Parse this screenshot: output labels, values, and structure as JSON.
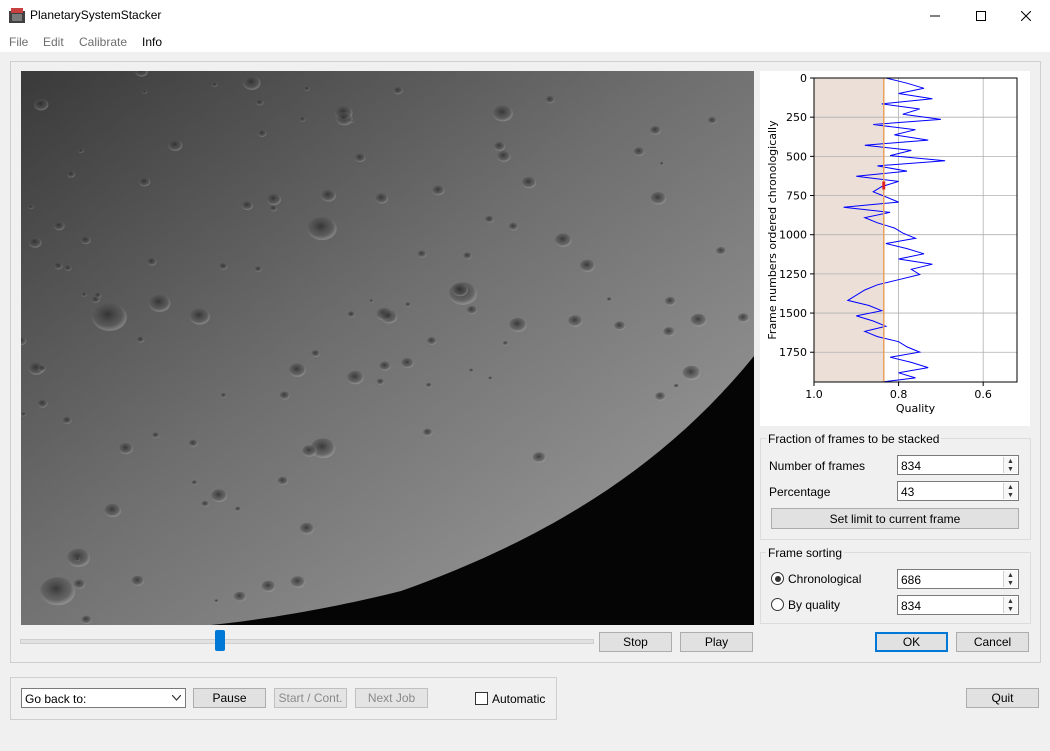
{
  "window": {
    "title": "PlanetarySystemStacker",
    "minimize_icon": "minimize-icon",
    "maximize_icon": "maximize-icon",
    "close_icon": "close-icon"
  },
  "menu": [
    "File",
    "Edit",
    "Calibrate",
    "Info"
  ],
  "frame_viewer": {
    "slider_fraction": 0.35,
    "stop_label": "Stop",
    "play_label": "Play"
  },
  "chart_data": {
    "type": "line",
    "ylabel": "Frame numbers ordered chronologically",
    "xlabel": "Quality",
    "xlim": [
      1.0,
      0.52
    ],
    "ylim": [
      0,
      1940
    ],
    "x_ticks": [
      "1.0",
      "0.8",
      "0.6"
    ],
    "y_ticks": [
      "0",
      "250",
      "500",
      "750",
      "1000",
      "1250",
      "1500",
      "1750"
    ],
    "grid": true,
    "y_inverted": true,
    "x_inverted": true,
    "series": [
      {
        "color": "#0000ff",
        "note_points": "quality per frame, sampled",
        "x": [
          0.83,
          0.78,
          0.74,
          0.8,
          0.72,
          0.84,
          0.75,
          0.79,
          0.7,
          0.86,
          0.76,
          0.81,
          0.73,
          0.88,
          0.77,
          0.82,
          0.69,
          0.85,
          0.78,
          0.9,
          0.8,
          0.84,
          0.86,
          0.83,
          0.8,
          0.93,
          0.82,
          0.88,
          0.85,
          0.81,
          0.79,
          0.76,
          0.83,
          0.78,
          0.74,
          0.8,
          0.72,
          0.77,
          0.75,
          0.8,
          0.85,
          0.88,
          0.9,
          0.92,
          0.87,
          0.84,
          0.9,
          0.86,
          0.83,
          0.88,
          0.85,
          0.8,
          0.78,
          0.75,
          0.82,
          0.77,
          0.73,
          0.8,
          0.76,
          0.84
        ],
        "y": [
          0,
          33,
          66,
          99,
          132,
          165,
          198,
          231,
          264,
          297,
          330,
          363,
          396,
          429,
          462,
          495,
          528,
          561,
          594,
          627,
          660,
          693,
          726,
          759,
          792,
          825,
          858,
          891,
          924,
          957,
          990,
          1023,
          1056,
          1089,
          1122,
          1155,
          1188,
          1221,
          1254,
          1287,
          1320,
          1353,
          1386,
          1419,
          1452,
          1485,
          1518,
          1551,
          1584,
          1617,
          1650,
          1683,
          1716,
          1749,
          1782,
          1815,
          1848,
          1881,
          1914,
          1940
        ]
      }
    ],
    "threshold_quality": 0.835,
    "current_frame": 686,
    "shaded_span_quality": [
      1.0,
      0.835
    ]
  },
  "stack_fraction": {
    "group_title": "Fraction of frames to be stacked",
    "frames_label": "Number of frames",
    "frames_value": "834",
    "percent_label": "Percentage",
    "percent_value": "43",
    "set_limit_label": "Set limit to current frame"
  },
  "frame_sorting": {
    "group_title": "Frame sorting",
    "chrono_label": "Chronological",
    "chrono_value": "686",
    "quality_label": "By quality",
    "quality_value": "834",
    "selected": "Chronological"
  },
  "dialog_buttons": {
    "ok": "OK",
    "cancel": "Cancel"
  },
  "workflow": {
    "go_back_label": "Go back to:",
    "chevron_icon": "chevron-down-icon",
    "pause": "Pause",
    "start_cont": "Start / Cont.",
    "next_job": "Next Job",
    "automatic": "Automatic",
    "automatic_checked": false
  },
  "quit_label": "Quit"
}
